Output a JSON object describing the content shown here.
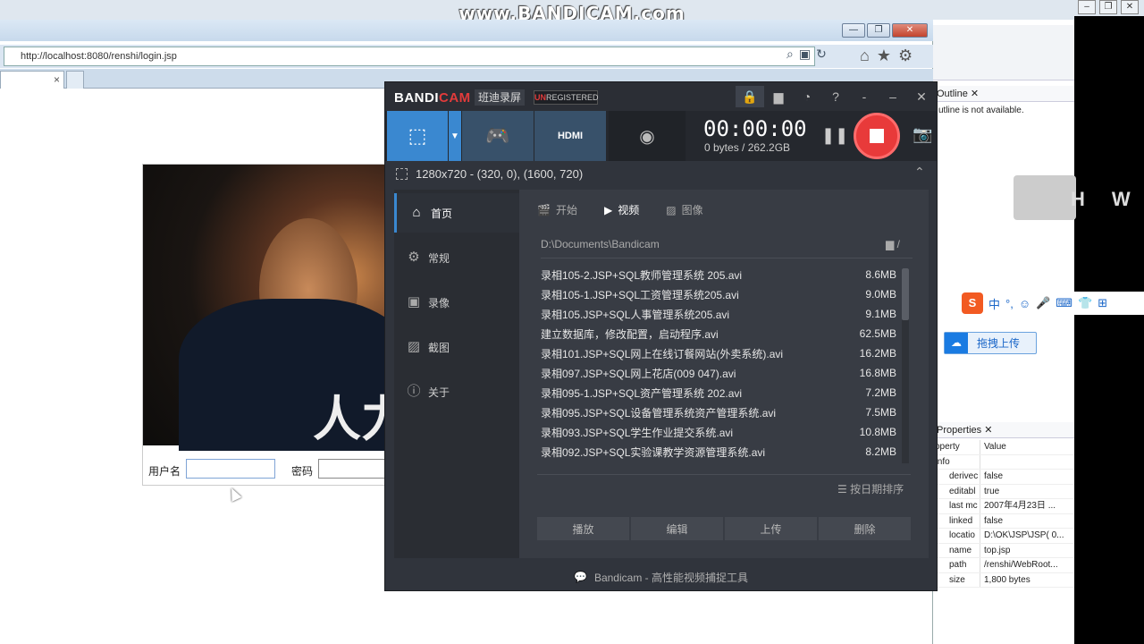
{
  "watermark": "www.BANDICAM.com",
  "desktop": {
    "controls": [
      "–",
      "❐",
      "✕"
    ]
  },
  "ie": {
    "window_controls": [
      "—",
      "❐",
      "✕"
    ],
    "address": "http://localhost:8080/renshi/login.jsp",
    "tab_close": "×"
  },
  "login": {
    "photo_text": "人力",
    "user_label": "用户名",
    "pass_label": "密码"
  },
  "eclipse": {
    "outline_tab": "Outline ✕",
    "outline_msg": "utline is not available.",
    "properties_tab": "Properties ✕",
    "props_header": {
      "k": "operty",
      "v": "Value"
    },
    "props_section": "Info",
    "props": [
      {
        "k": "derivec",
        "v": "false"
      },
      {
        "k": "editabl",
        "v": "true"
      },
      {
        "k": "last mc",
        "v": "2007年4月23日 ..."
      },
      {
        "k": "linked",
        "v": "false"
      },
      {
        "k": "locatio",
        "v": "D:\\OK\\JSP\\JSP( 0..."
      },
      {
        "k": "name",
        "v": "top.jsp"
      },
      {
        "k": "path",
        "v": "/renshi/WebRoot..."
      },
      {
        "k": "size",
        "v": "1,800  bytes"
      }
    ]
  },
  "ime": {
    "letters": [
      "H",
      "W"
    ],
    "sogou_items": [
      "中",
      "°,",
      "☺",
      "🎤",
      "⌨",
      "👕",
      "⊞"
    ],
    "upload": "拖拽上传"
  },
  "bandicam": {
    "brand_a": "BANDI",
    "brand_b": "CAM",
    "brand_cn": "班迪录屏",
    "unreg_a": "UN",
    "unreg_b": "REGISTERED",
    "timer": "00:00:00",
    "size": "0 bytes / 262.2GB",
    "area": "1280x720 - (320, 0), (1600, 720)",
    "hdmi": "HDMI",
    "sidebar": [
      "首页",
      "常规",
      "录像",
      "截图",
      "关于"
    ],
    "subtabs": [
      "开始",
      "视频",
      "图像"
    ],
    "path": "D:\\Documents\\Bandicam",
    "path_suffix": "/",
    "files": [
      {
        "name": "录相105-2.JSP+SQL教师管理系统 205.avi",
        "size": "8.6MB"
      },
      {
        "name": "录相105-1.JSP+SQL工资管理系统205.avi",
        "size": "9.0MB"
      },
      {
        "name": "录相105.JSP+SQL人事管理系统205.avi",
        "size": "9.1MB"
      },
      {
        "name": "建立数据库，修改配置，启动程序.avi",
        "size": "62.5MB"
      },
      {
        "name": "录相101.JSP+SQL网上在线订餐网站(外卖系统).avi",
        "size": "16.2MB"
      },
      {
        "name": "录相097.JSP+SQL网上花店(009  047).avi",
        "size": "16.8MB"
      },
      {
        "name": "录相095-1.JSP+SQL资产管理系统 202.avi",
        "size": "7.2MB"
      },
      {
        "name": "录相095.JSP+SQL设备管理系统资产管理系统.avi",
        "size": "7.5MB"
      },
      {
        "name": "录相093.JSP+SQL学生作业提交系统.avi",
        "size": "10.8MB"
      },
      {
        "name": "录相092.JSP+SQL实验课教学资源管理系统.avi",
        "size": "8.2MB"
      }
    ],
    "sort": "按日期排序",
    "actions": [
      "播放",
      "编辑",
      "上传",
      "删除"
    ],
    "footer": "Bandicam - 高性能视频捕捉工具"
  }
}
